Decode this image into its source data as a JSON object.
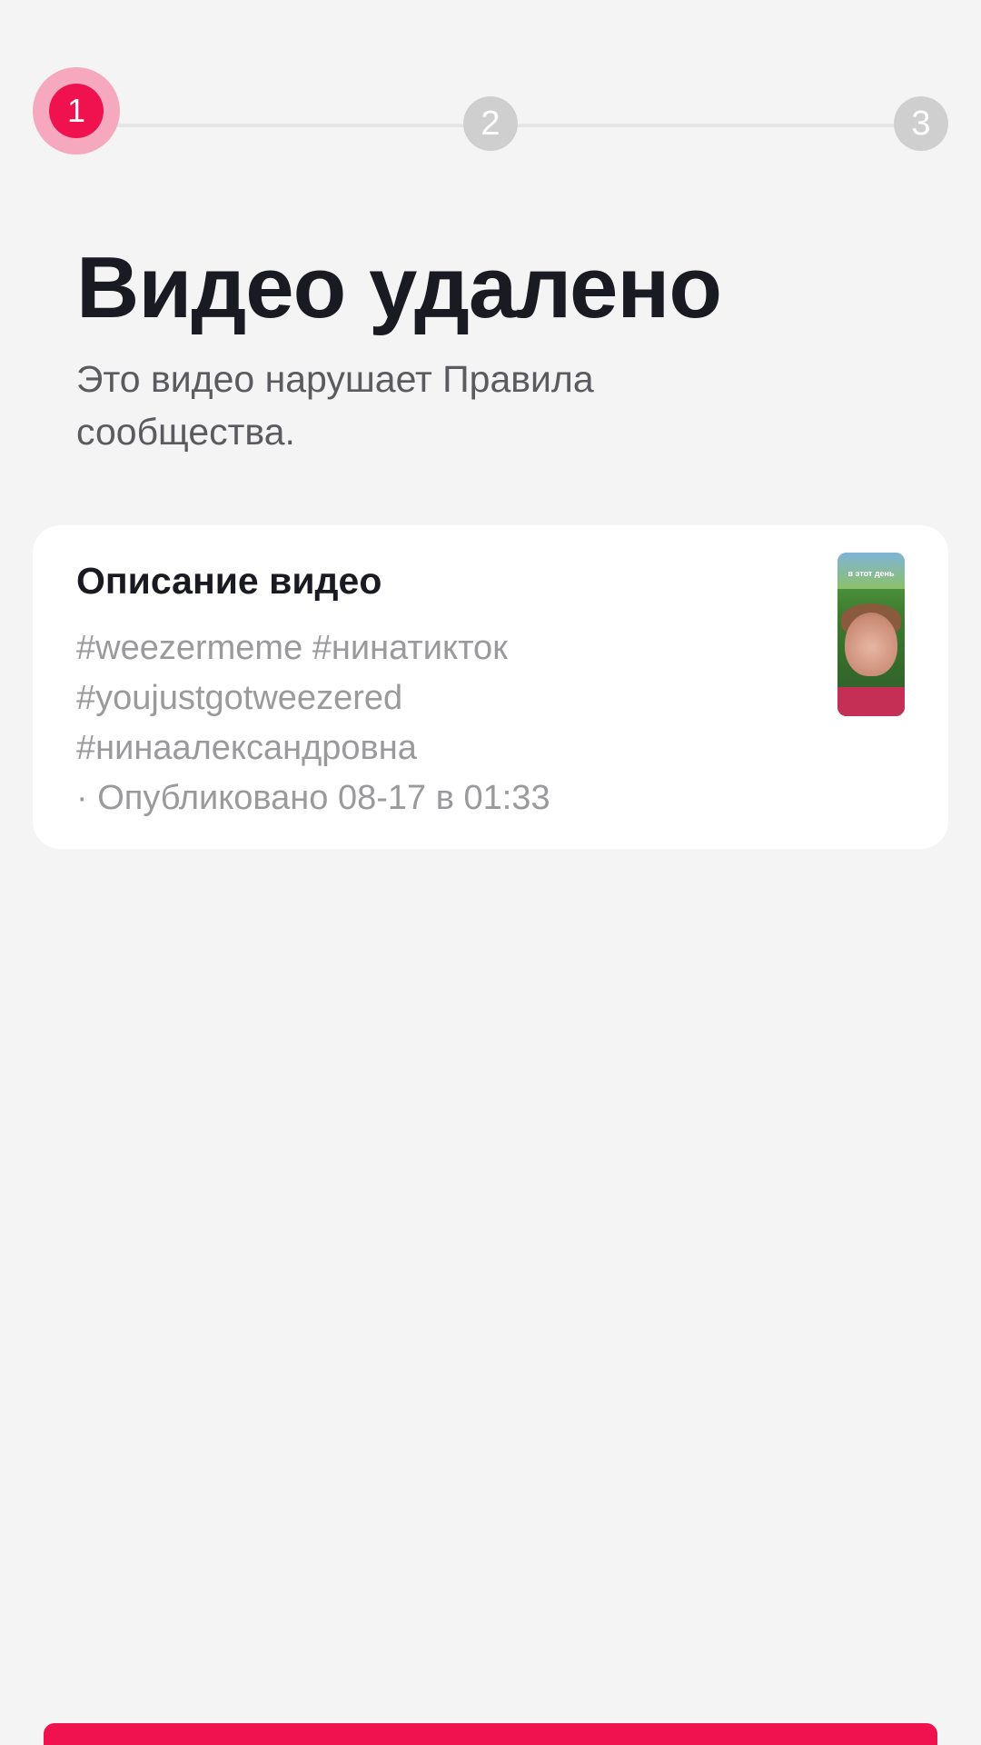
{
  "stepper": {
    "steps": [
      "1",
      "2",
      "3"
    ],
    "active_step": 1,
    "colors": {
      "active": "#f0114f",
      "inactive": "#cfcfcf"
    }
  },
  "header": {
    "title": "Видео удалено",
    "subtitle": "Это видео нарушает Правила сообщества."
  },
  "video_card": {
    "title": "Описание видео",
    "hashtags": [
      "#weezermeme #нинатикток",
      "#youjustgotweezered",
      "#нинаалександровна"
    ],
    "published": "· Опубликовано 08-17 в 01:33",
    "thumbnail_caption": "в этот день"
  },
  "footer": {
    "primary_button_label": "",
    "accent_color": "#f0114f"
  }
}
